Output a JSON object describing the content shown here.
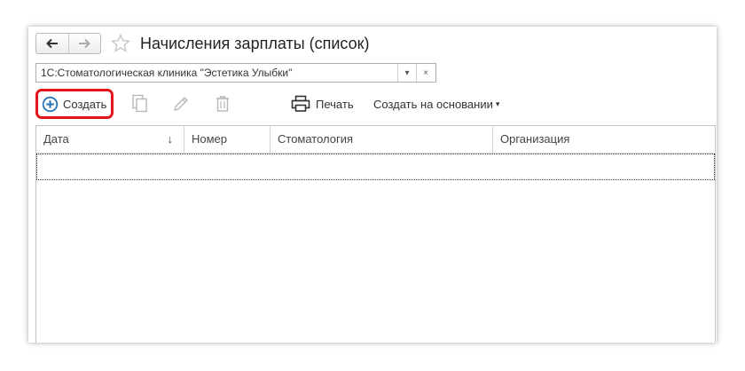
{
  "window": {
    "title": "Начисления зарплаты (список)"
  },
  "icons": {
    "back": "arrow-left-icon",
    "forward": "arrow-right-icon",
    "favorite": "star-icon",
    "dropdown": "chevron-down-icon",
    "clear": "close-icon",
    "create": "plus-circle-icon",
    "copy": "copy-icon",
    "edit": "pencil-icon",
    "delete": "trash-icon",
    "print": "printer-icon"
  },
  "organization": {
    "value": "1С:Стоматологическая клиника \"Эстетика Улыбки\"",
    "dropdown_glyph": "▾",
    "clear_glyph": "×"
  },
  "toolbar": {
    "create_label": "Создать",
    "print_label": "Печать",
    "create_based_label": "Создать на основании",
    "create_based_arrow": "▾"
  },
  "table": {
    "columns": [
      "Дата",
      "Номер",
      "Стоматология",
      "Организация"
    ],
    "sort_indicator": "↓",
    "rows": []
  },
  "colors": {
    "accent": "#1f6fb5",
    "highlight": "#e3151a",
    "disabled_icon": "#b8b8b8"
  }
}
